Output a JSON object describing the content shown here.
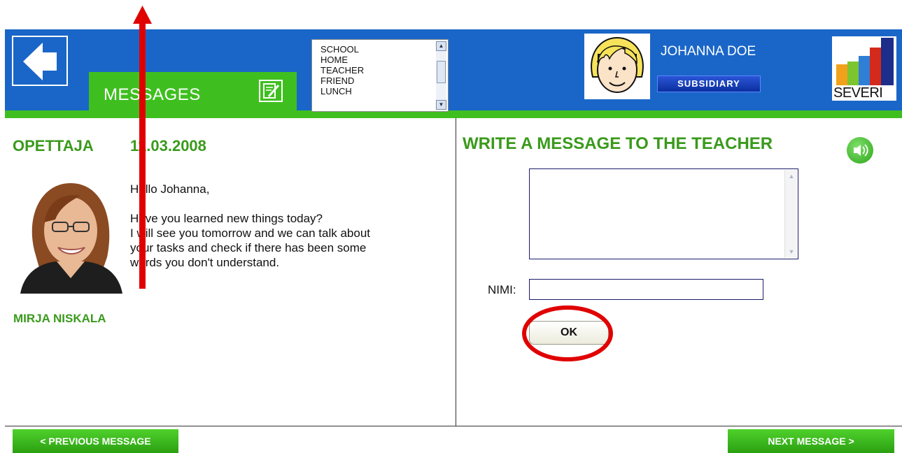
{
  "header": {
    "tab_label": "MESSAGES",
    "categories": [
      "SCHOOL",
      "HOME",
      "TEACHER",
      "FRIEND",
      "LUNCH"
    ],
    "user_name": "JOHANNA DOE",
    "subsidiary_label": "SUBSIDIARY",
    "logo_text": "SEVERI"
  },
  "message": {
    "sender_title": "OPETTAJA",
    "date": "11.03.2008",
    "greeting": "Hello Johanna,",
    "body_lines": [
      "Have you learned new things today?",
      "I will see you tomorrow and we can talk about",
      "your tasks and check if there has been some",
      "words you don't understand."
    ],
    "teacher_name": "MIRJA NISKALA"
  },
  "compose": {
    "title": "WRITE A MESSAGE TO THE TEACHER",
    "message_value": "",
    "name_label": "NIMI:",
    "name_value": "",
    "ok_label": "OK"
  },
  "footer": {
    "prev_label": "< PREVIOUS MESSAGE",
    "next_label": "NEXT MESSAGE >"
  },
  "colors": {
    "header_blue": "#1a66c8",
    "accent_green": "#3fbf1f",
    "title_green": "#3a9a1c",
    "annotation_red": "#e00000"
  },
  "icons": {
    "back": "back-arrow-icon",
    "compose": "edit-note-icon",
    "speaker": "speaker-icon"
  }
}
